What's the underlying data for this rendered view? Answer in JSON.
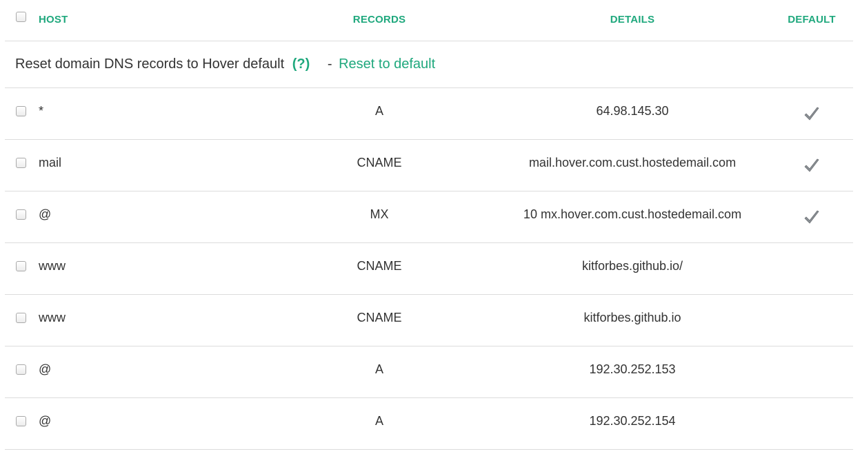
{
  "header": {
    "host": "HOST",
    "records": "RECORDS",
    "details": "DETAILS",
    "default": "DEFAULT"
  },
  "reset": {
    "text": "Reset domain DNS records to Hover default",
    "help": "(?)",
    "dash": "-",
    "link": "Reset to default"
  },
  "rows": [
    {
      "host": "*",
      "record": "A",
      "details": "64.98.145.30",
      "default": true
    },
    {
      "host": "mail",
      "record": "CNAME",
      "details": "mail.hover.com.cust.hostedemail.com",
      "default": true
    },
    {
      "host": "@",
      "record": "MX",
      "details": "10 mx.hover.com.cust.hostedemail.com",
      "default": true
    },
    {
      "host": "www",
      "record": "CNAME",
      "details": "kitforbes.github.io/",
      "default": false
    },
    {
      "host": "www",
      "record": "CNAME",
      "details": "kitforbes.github.io",
      "default": false
    },
    {
      "host": "@",
      "record": "A",
      "details": "192.30.252.153",
      "default": false
    },
    {
      "host": "@",
      "record": "A",
      "details": "192.30.252.154",
      "default": false
    }
  ],
  "colors": {
    "accent": "#1fa87d",
    "text": "#333333",
    "divider": "#dcdcdc",
    "check": "#8a8f94"
  },
  "icons": {
    "default_marker": "check-icon"
  }
}
